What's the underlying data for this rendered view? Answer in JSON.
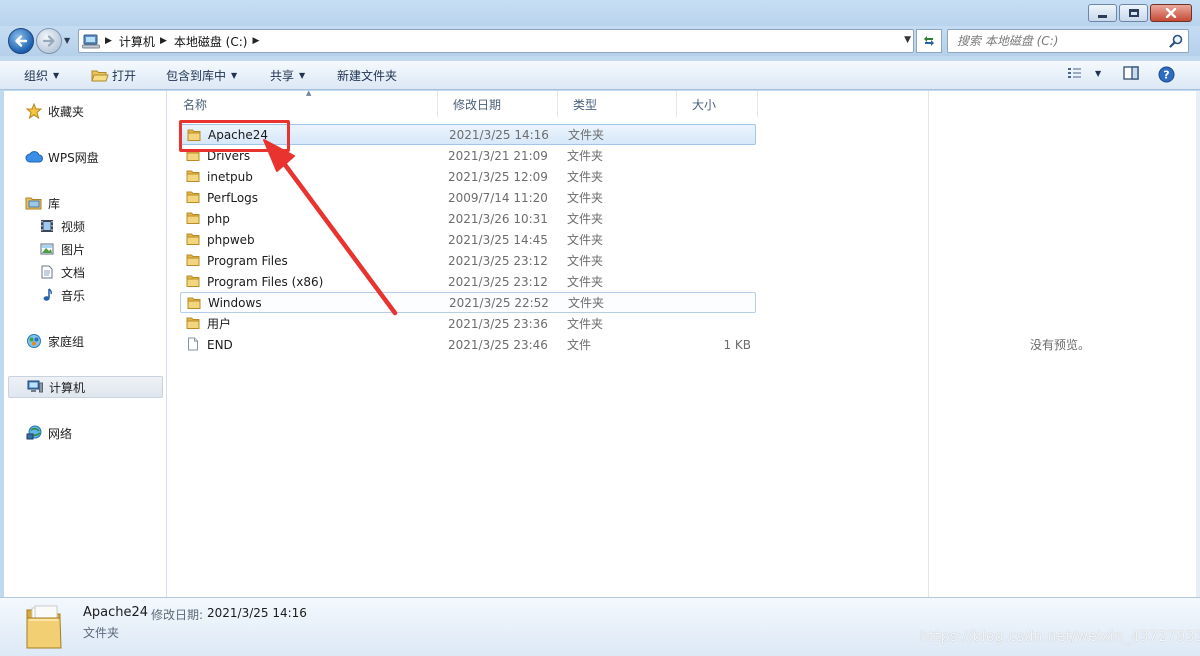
{
  "window": {
    "caption_buttons": [
      "minimize",
      "maximize",
      "close"
    ]
  },
  "address_bar": {
    "breadcrumbs": [
      "计算机",
      "本地磁盘 (C:)"
    ],
    "search_placeholder": "搜索 本地磁盘 (C:)"
  },
  "toolbar": {
    "organize": "组织",
    "open": "打开",
    "include_in_library": "包含到库中",
    "share": "共享",
    "new_folder": "新建文件夹"
  },
  "nav_pane": {
    "favorites": "收藏夹",
    "wps_cloud": "WPS网盘",
    "libraries": "库",
    "library_items": [
      "视频",
      "图片",
      "文档",
      "音乐"
    ],
    "homegroup": "家庭组",
    "computer": "计算机",
    "network": "网络"
  },
  "columns": {
    "name": "名称",
    "date_modified": "修改日期",
    "type": "类型",
    "size": "大小"
  },
  "files": [
    {
      "name": "Apache24",
      "date": "2021/3/25 14:16",
      "type": "文件夹",
      "size": "",
      "kind": "folder",
      "selected": true
    },
    {
      "name": "Drivers",
      "date": "2021/3/21 21:09",
      "type": "文件夹",
      "size": "",
      "kind": "folder"
    },
    {
      "name": "inetpub",
      "date": "2021/3/25 12:09",
      "type": "文件夹",
      "size": "",
      "kind": "folder"
    },
    {
      "name": "PerfLogs",
      "date": "2009/7/14 11:20",
      "type": "文件夹",
      "size": "",
      "kind": "folder"
    },
    {
      "name": "php",
      "date": "2021/3/26 10:31",
      "type": "文件夹",
      "size": "",
      "kind": "folder"
    },
    {
      "name": "phpweb",
      "date": "2021/3/25 14:45",
      "type": "文件夹",
      "size": "",
      "kind": "folder"
    },
    {
      "name": "Program Files",
      "date": "2021/3/25 23:12",
      "type": "文件夹",
      "size": "",
      "kind": "folder"
    },
    {
      "name": "Program Files (x86)",
      "date": "2021/3/25 23:12",
      "type": "文件夹",
      "size": "",
      "kind": "folder"
    },
    {
      "name": "Windows",
      "date": "2021/3/25 22:52",
      "type": "文件夹",
      "size": "",
      "kind": "folder",
      "hover": true
    },
    {
      "name": "用户",
      "date": "2021/3/25 23:36",
      "type": "文件夹",
      "size": "",
      "kind": "folder"
    },
    {
      "name": "END",
      "date": "2021/3/25 23:46",
      "type": "文件",
      "size": "1 KB",
      "kind": "file"
    }
  ],
  "preview": {
    "message": "没有预览。"
  },
  "details": {
    "name": "Apache24",
    "date_label": "修改日期:",
    "date": "2021/3/25 14:16",
    "type": "文件夹"
  },
  "watermark": "https://blog.csdn.net/weixin_43727933",
  "colors": {
    "selection": "#d6e8f9",
    "annotation": "#e8332f",
    "chrome": "#bfd9ef"
  }
}
